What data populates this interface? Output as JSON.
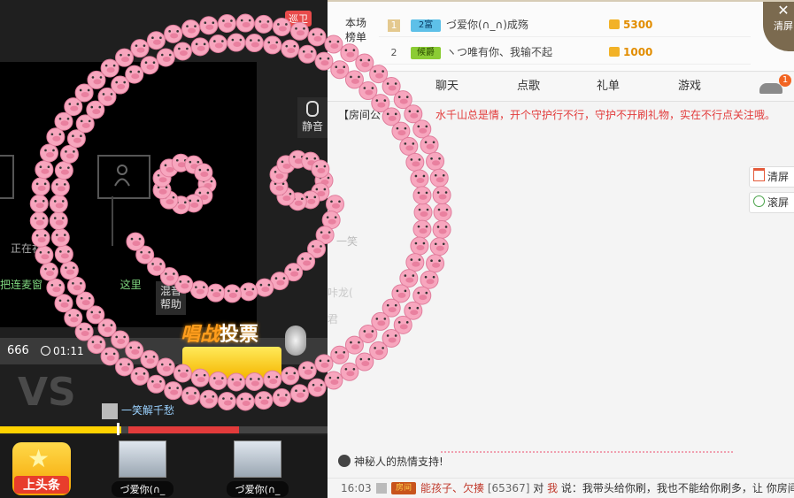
{
  "video": {
    "connecting_text": "正在初",
    "mic_hint": "把连麦窗",
    "mic_hint_tail": "这里",
    "mute_label": "静音",
    "mix_help": "混音帮助",
    "hot_tag": "巡卫",
    "score": "666",
    "timer": "01:11",
    "vs_label": "VS",
    "vote_prefix": "唱战",
    "vote_suffix": "投票",
    "vs_user": "一笑解千愁",
    "progress_fraction": 0.37,
    "headline_label": "上头条",
    "fans": [
      {
        "name": "づ爱你(∩_"
      },
      {
        "name": "づ爱你(∩_"
      }
    ]
  },
  "rank": {
    "label": "本场榜单",
    "rows": [
      {
        "num": "1",
        "badge": "2富",
        "name": "づ爱你(∩_∩)成殇",
        "value": "5300"
      },
      {
        "num": "2",
        "badge": "候爵",
        "name": "ヽつ唯有你、我输不起",
        "value": "1000"
      }
    ],
    "clear_screen": "清屏"
  },
  "tabs": {
    "chat": "聊天",
    "song": "点歌",
    "gift": "礼单",
    "game": "游戏",
    "car_badge": "1"
  },
  "notice": {
    "prefix": "【房间公",
    "text": "水千山总是情，开个守护行不行，守护不开刷礼物，实在不行点关注哦。"
  },
  "side_buttons": {
    "clear": "清屏",
    "scroll": "滚屏"
  },
  "faded": {
    "line1": "一笑",
    "line2": "咔龙(",
    "line3": "君"
  },
  "support": "神秘人的热情支持!",
  "chat": {
    "time": "16:03",
    "medal": "房间",
    "user": "能孩子、欠揍",
    "uid": "[65367]",
    "to": "对",
    "me": "我",
    "says": "说：",
    "message": "我带头给你刷，我也不能给你刷多，让 你房间人"
  },
  "colors": {
    "pig_pink": "#f7a6be",
    "accent_red": "#e23b3b",
    "coin_gold": "#e28d00"
  }
}
